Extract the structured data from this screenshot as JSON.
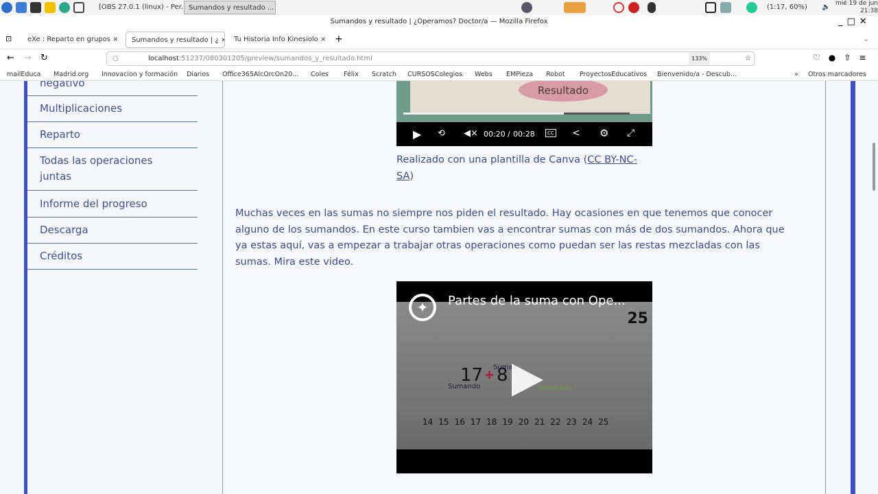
{
  "taskbar": {
    "tasks": [
      "[OBS 27.0.1 (linux) - Per...",
      "Sumandos y resultado ..."
    ],
    "battery": "(1:17, 60%)",
    "date": "mié 19 de jun",
    "time": "21:38"
  },
  "window": {
    "title": "Sumandos y resultado | ¿Operamos? Doctor/a — Mozilla Firefox"
  },
  "tabs": [
    {
      "label": "eXe : Reparto en grupos"
    },
    {
      "label": "Sumandos y resultado | ¿"
    },
    {
      "label": "Tu Historia Info Kinesiolo"
    }
  ],
  "navbar": {
    "url_host": "localhost",
    "url_path": ":51237/080301205/preview/sumandos_y_resultado.html",
    "zoom": "133%"
  },
  "bookmarks": [
    "mailEduca",
    "Madrid.org",
    "Innovacion y formación",
    "Diarios",
    "Office365AlcOrcOn20...",
    "Coles",
    "Félix",
    "Scratch",
    "CURSOSColegios",
    "Webs",
    "EMPieza",
    "Robot",
    "ProyectosEducativos",
    "Bienvenido/a - Descub...",
    "Otros marcadores"
  ],
  "sidebar": {
    "items": [
      "negativo",
      "Multiplicaciones",
      "Reparto",
      "Todas las operaciones juntas",
      "Informe del progreso",
      "Descarga",
      "Créditos"
    ]
  },
  "video1": {
    "overlay_label": "Resultado",
    "current_time": "00:20",
    "separator": "/",
    "duration": "00:28",
    "progress": 0.71
  },
  "caption": {
    "text": "Realizado con una plantilla de Canva (",
    "link": "CC BY-NC-SA",
    "close": ")"
  },
  "paragraph": "Muchas veces en las sumas no siempre nos piden el resultado. Hay ocasiones en que tenemos que conocer alguno de los sumandos. En este curso tambien vas a encontrar sumas con más de dos sumandos. Ahora que ya estas aquí, vas a empezar a trabajar otras operaciones como puedan ser las restas mezcladas con las sumas. Mira este video.",
  "video2": {
    "title": "Partes de la suma con Ope...",
    "corner_number": "25",
    "equation_a": "17",
    "equation_plus": "+",
    "equation_b": "8",
    "label_sumando": "Sumando",
    "label_sumando2": "Suman",
    "label_resultado": "Resultado",
    "number_line": [
      "14",
      "15",
      "16",
      "17",
      "18",
      "19",
      "20",
      "21",
      "22",
      "23",
      "24",
      "25"
    ]
  }
}
